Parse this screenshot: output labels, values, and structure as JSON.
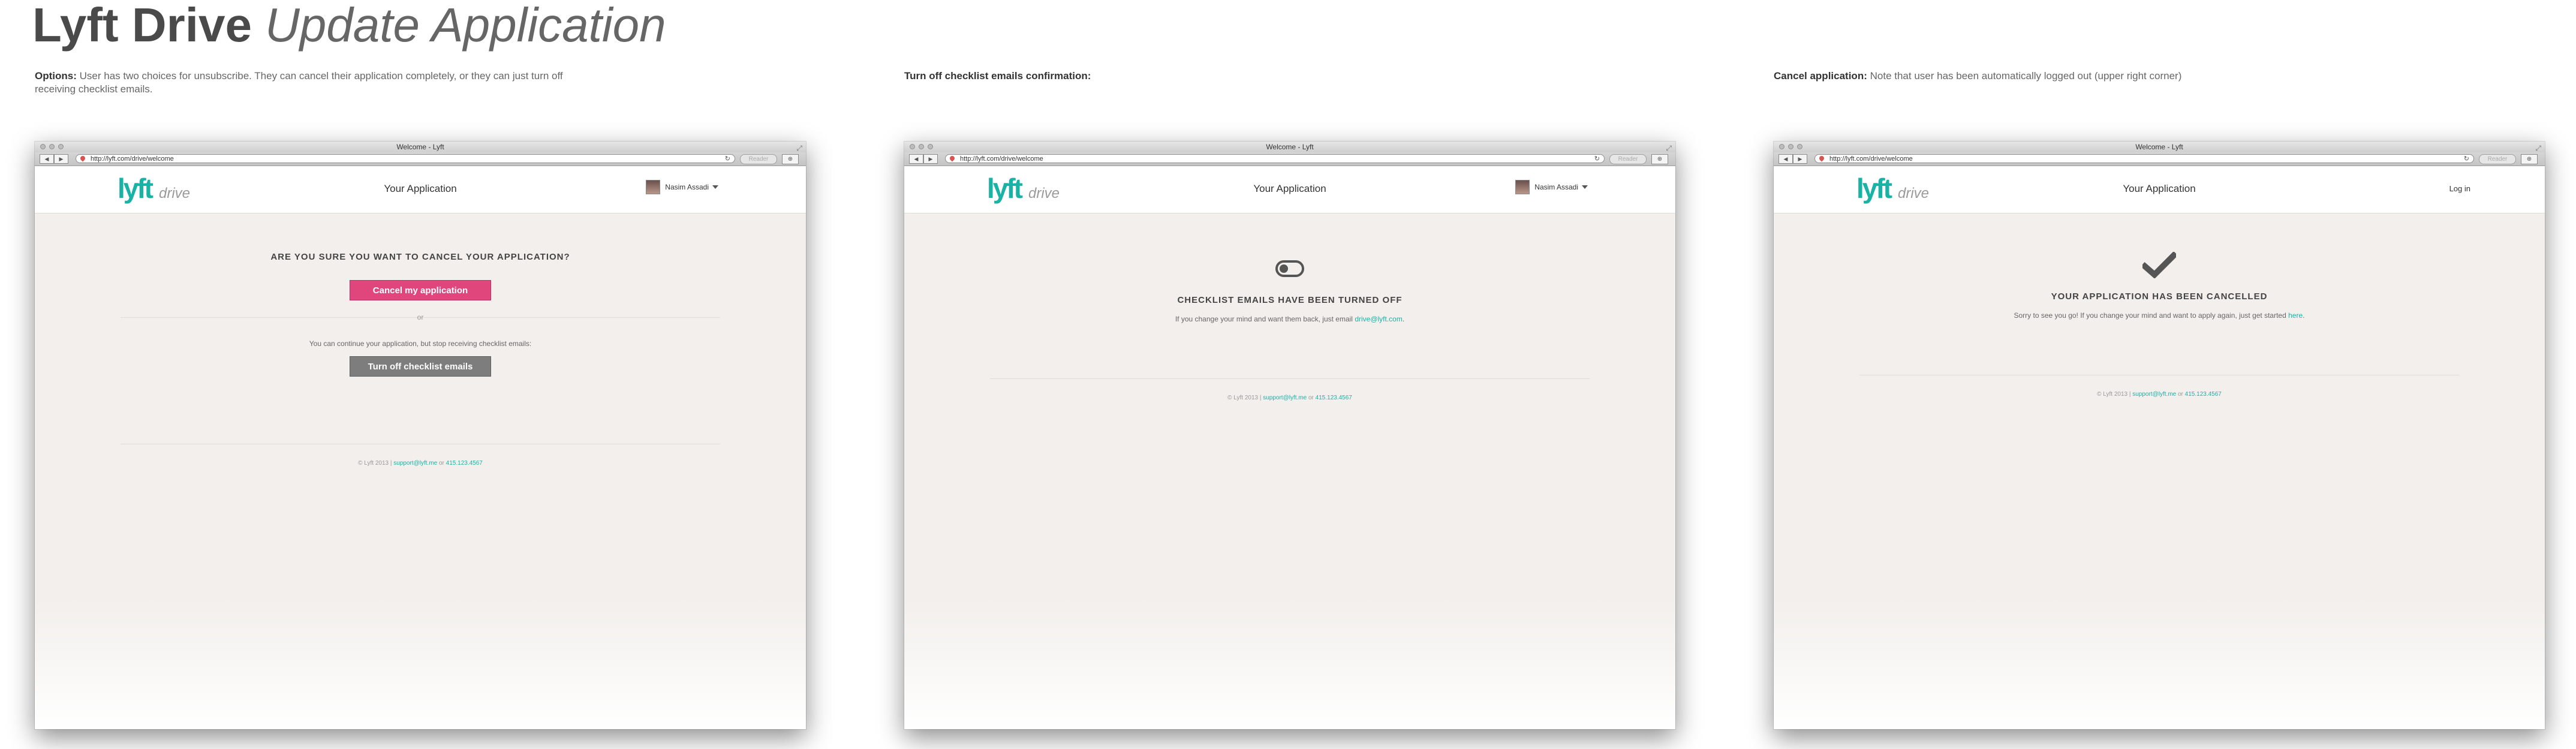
{
  "title": {
    "brand": "Lyft Drive",
    "subtitle": "Update Application"
  },
  "captions": [
    {
      "label": "Options:",
      "text": "User has two choices for unsubscribe. They can cancel their application completely, or they can just turn off receiving checklist emails."
    },
    {
      "label": "Turn off checklist emails confirmation:",
      "text": ""
    },
    {
      "label": "Cancel application:",
      "text": "Note that user has been automatically logged out (upper right corner)"
    }
  ],
  "browser": {
    "window_title": "Welcome - Lyft",
    "url": "http://lyft.com/drive/welcome",
    "reader_label": "Reader"
  },
  "site": {
    "logo_text": "lyft",
    "logo_sub": "drive",
    "header_title": "Your Application",
    "user_name": "Nasim Assadi",
    "login_label": "Log in"
  },
  "screen1": {
    "heading": "ARE YOU SURE YOU WANT TO CANCEL YOUR APPLICATION?",
    "cancel_button": "Cancel my application",
    "or": "or",
    "note": "You can continue your application, but stop receiving checklist emails:",
    "turnoff_button": "Turn off checklist emails"
  },
  "screen2": {
    "heading": "CHECKLIST EMAILS HAVE BEEN TURNED OFF",
    "note": "If you change your mind and want them back, just email",
    "email": "drive@lyft.com",
    "note_end": "."
  },
  "screen3": {
    "heading": "YOUR APPLICATION HAS BEEN CANCELLED",
    "note": "Sorry to see you go! If you change your mind and want to apply again, just get started",
    "link": "here",
    "note_end": "."
  },
  "footer": {
    "copyright": "© Lyft 2013 |",
    "support_email": "support@lyft.me",
    "or": "or",
    "phone": "415.123.4567"
  },
  "colors": {
    "lyft_teal": "#19b3a6",
    "cancel_pink": "#e0467c",
    "turnoff_gray": "#7d7d7d"
  }
}
